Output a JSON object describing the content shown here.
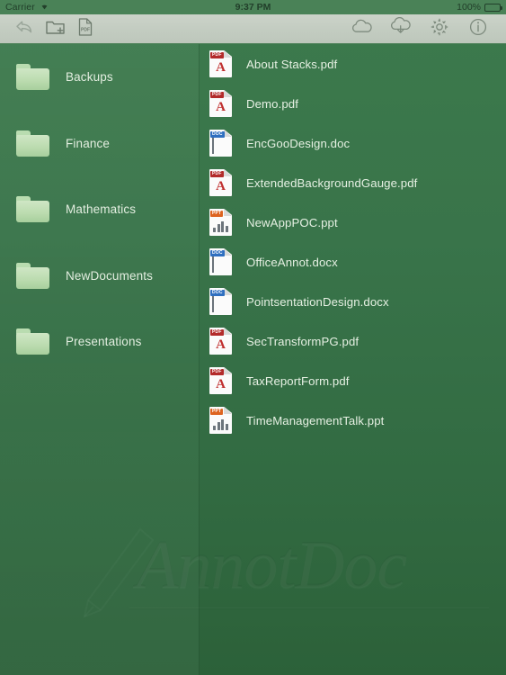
{
  "statusbar": {
    "carrier": "Carrier",
    "wifi_icon": "wifi-icon",
    "time": "9:37 PM",
    "battery_percent": "100%",
    "battery_icon": "battery-full-icon"
  },
  "toolbar": {
    "back": {
      "name": "back-icon",
      "label": "Back",
      "disabled": true
    },
    "new_folder": {
      "name": "new-folder-icon",
      "label": "New Folder"
    },
    "new_document": {
      "name": "new-pdf-document-icon",
      "label": "New Document"
    },
    "cloud_upload": {
      "name": "cloud-icon",
      "label": "Cloud"
    },
    "cloud_download": {
      "name": "cloud-download-icon",
      "label": "Download"
    },
    "settings": {
      "name": "gear-icon",
      "label": "Settings"
    },
    "info": {
      "name": "info-icon",
      "label": "Info"
    }
  },
  "sidebar": {
    "items": [
      {
        "label": "Backups",
        "icon": "folder-icon"
      },
      {
        "label": "Finance",
        "icon": "folder-icon"
      },
      {
        "label": "Mathematics",
        "icon": "folder-icon"
      },
      {
        "label": "NewDocuments",
        "icon": "folder-icon"
      },
      {
        "label": "Presentations",
        "icon": "folder-icon"
      }
    ]
  },
  "filelist": {
    "items": [
      {
        "name": "About Stacks.pdf",
        "type": "pdf",
        "badge": "PDF",
        "icon": "pdf-file-icon"
      },
      {
        "name": "Demo.pdf",
        "type": "pdf",
        "badge": "PDF",
        "icon": "pdf-file-icon"
      },
      {
        "name": "EncGooDesign.doc",
        "type": "doc",
        "badge": "DOC",
        "icon": "doc-file-icon"
      },
      {
        "name": "ExtendedBackgroundGauge.pdf",
        "type": "pdf",
        "badge": "PDF",
        "icon": "pdf-file-icon"
      },
      {
        "name": "NewAppPOC.ppt",
        "type": "ppt",
        "badge": "PPT",
        "icon": "ppt-file-icon"
      },
      {
        "name": "OfficeAnnot.docx",
        "type": "doc",
        "badge": "DOC",
        "icon": "doc-file-icon"
      },
      {
        "name": "PointsentationDesign.docx",
        "type": "doc",
        "badge": "DOC",
        "icon": "doc-file-icon"
      },
      {
        "name": "SecTransformPG.pdf",
        "type": "pdf",
        "badge": "PDF",
        "icon": "pdf-file-icon"
      },
      {
        "name": "TaxReportForm.pdf",
        "type": "pdf",
        "badge": "PDF",
        "icon": "pdf-file-icon"
      },
      {
        "name": "TimeManagementTalk.ppt",
        "type": "ppt",
        "badge": "PPT",
        "icon": "ppt-file-icon"
      }
    ]
  },
  "watermark": {
    "text": "AnnotDoc",
    "icon": "pencil-icon"
  },
  "colors": {
    "background_top": "#3c7a4c",
    "background_bottom": "#2c6139",
    "toolbar": "#c3ccc1",
    "statusbar": "#4a8257",
    "folder": "#bcdcb0",
    "pdf_badge": "#b32b2b",
    "doc_badge": "#2f6fc0",
    "ppt_badge": "#dd6320",
    "text": "#e6f0e3"
  }
}
